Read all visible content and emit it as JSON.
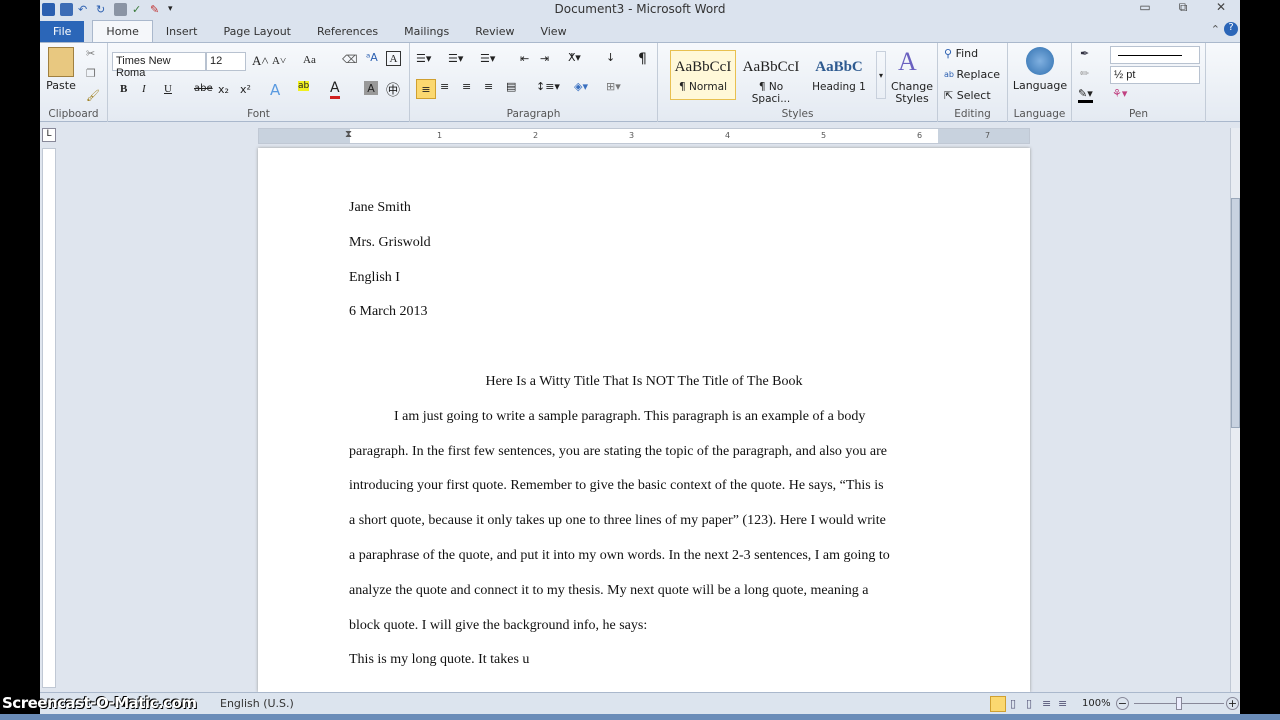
{
  "window": {
    "title": "Document3 - Microsoft Word",
    "minimize": "▭",
    "restore": "⧉",
    "close": "✕"
  },
  "tabs": [
    "File",
    "Home",
    "Insert",
    "Page Layout",
    "References",
    "Mailings",
    "Review",
    "View"
  ],
  "ribbon": {
    "clipboard": {
      "label": "Clipboard",
      "paste": "Paste"
    },
    "font": {
      "label": "Font",
      "name": "Times New Roma",
      "size": "12",
      "bold": "B",
      "italic": "I",
      "underline": "U",
      "strike": "abe",
      "sub": "x₂",
      "sup": "x²",
      "grow": "A˄",
      "shrink": "A˅",
      "case": "Aa"
    },
    "paragraph": {
      "label": "Paragraph",
      "pilcrow": "¶"
    },
    "styles": {
      "label": "Styles",
      "items": [
        {
          "sample": "AaBbCcI",
          "name": "¶ Normal"
        },
        {
          "sample": "AaBbCcI",
          "name": "¶ No Spaci..."
        },
        {
          "sample": "AaBbC",
          "name": "Heading 1"
        }
      ],
      "change": "Change Styles"
    },
    "editing": {
      "label": "Editing",
      "find": "Find",
      "replace": "Replace",
      "select": "Select"
    },
    "language": {
      "label": "Language",
      "button": "Language"
    },
    "pen": {
      "label": "Pen",
      "weight": "½ pt"
    }
  },
  "ruler": {
    "marks": [
      "1",
      "2",
      "3",
      "4",
      "5",
      "6",
      "7"
    ]
  },
  "document": {
    "heading": [
      "Jane Smith",
      "Mrs. Griswold",
      "English I",
      "6 March 2013"
    ],
    "title": "Here Is a Witty Title That Is NOT The Title of The Book",
    "lines": [
      "I am just going to write a sample paragraph.  This paragraph is an example of a body",
      "paragraph.  In the first few sentences, you are stating the topic of the paragraph, and also you are",
      "introducing your first quote.  Remember to give the basic context of the quote.  He says, “This is",
      "a short quote, because it only takes up one to three lines of my paper” (123).  Here I would write",
      "a paraphrase of the quote, and put it into my own words.  In the next 2-3 sentences, I am going to",
      "analyze the quote and connect it to my thesis.  My next quote will be a long quote, meaning a",
      "block quote.  I will give the background info, he says:",
      "This is my long quote.  It takes u"
    ]
  },
  "status": {
    "language": "English (U.S.)",
    "zoom": "100%",
    "zoom_fraction": 0.5
  },
  "watermark": "Screencast-O-Matic.com"
}
